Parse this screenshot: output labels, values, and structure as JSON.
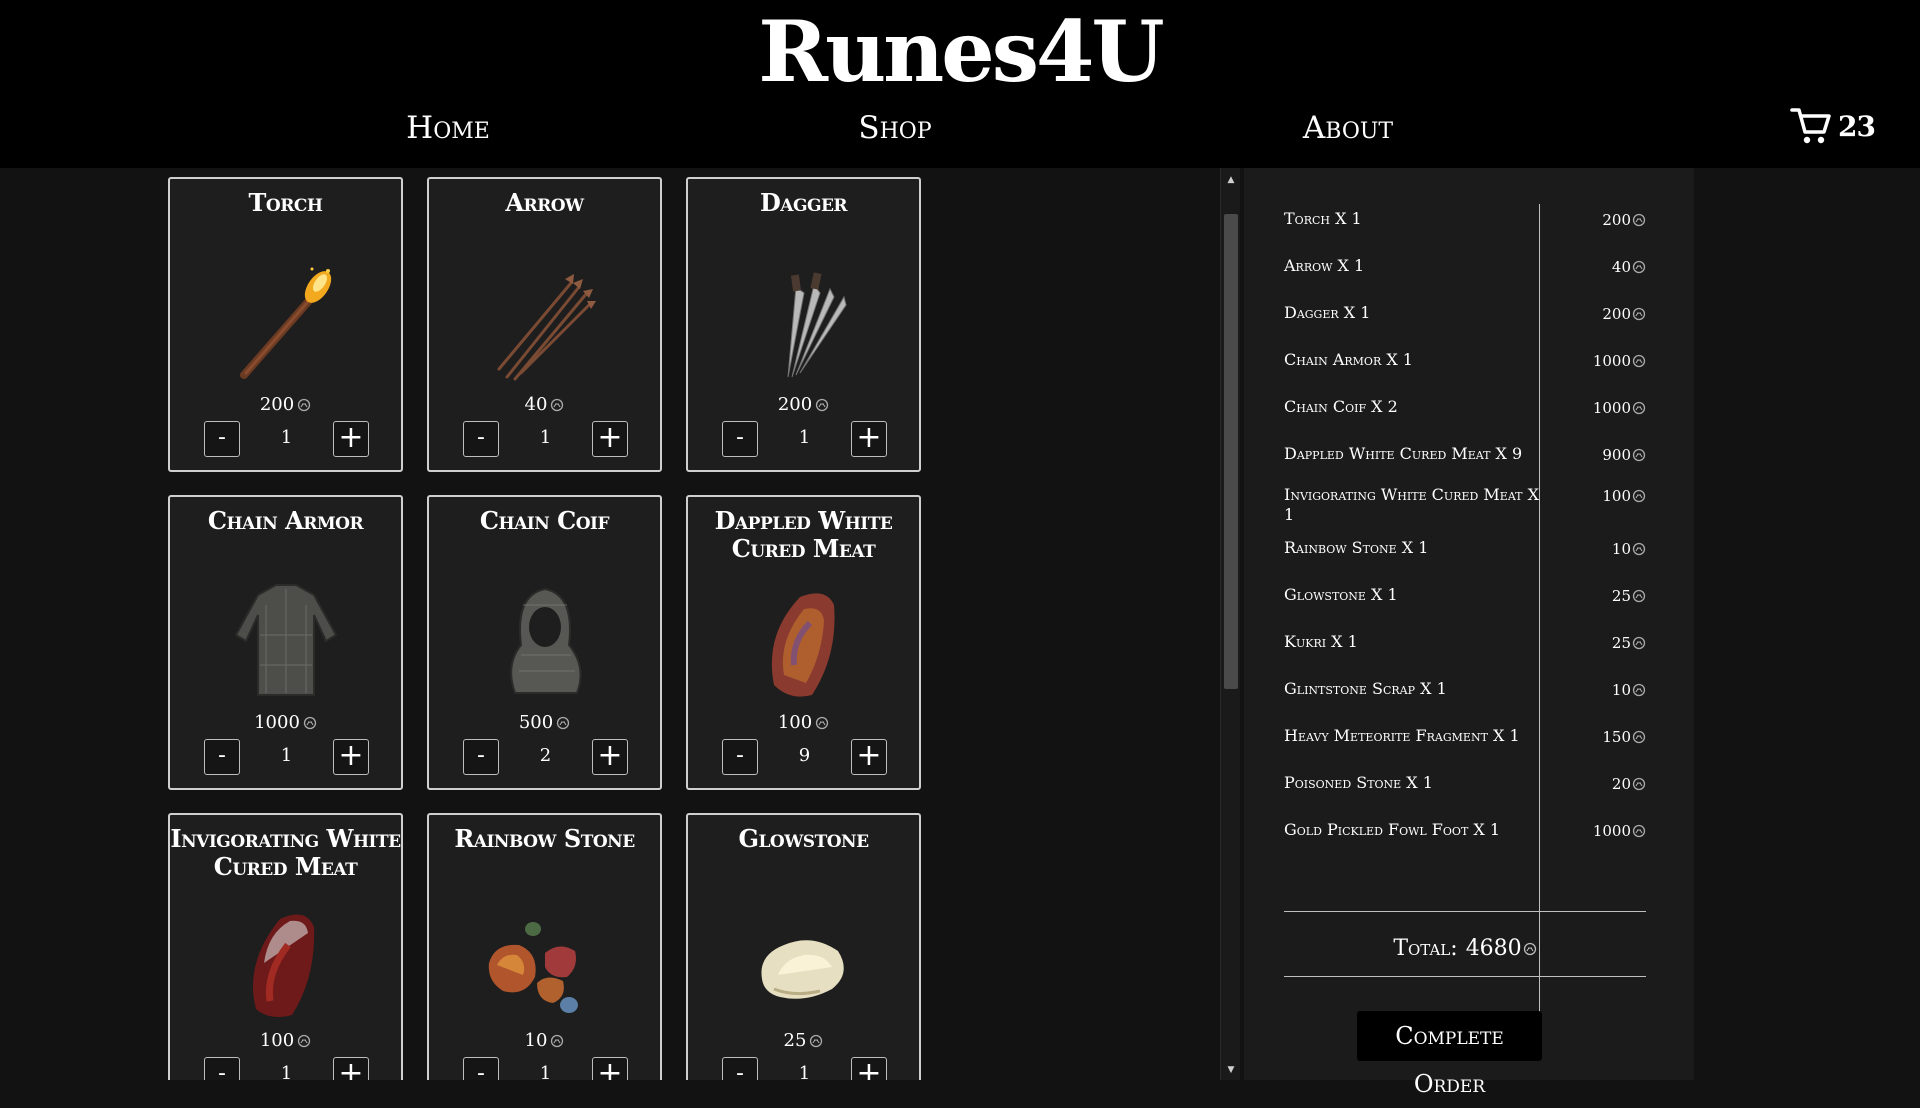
{
  "header": {
    "logo": "Runes4U",
    "nav": {
      "home": "Home",
      "shop": "Shop",
      "about": "About"
    },
    "cart_count": "23"
  },
  "products": [
    {
      "name": "Torch",
      "price": "200",
      "qty": "1",
      "image": "torch-icon"
    },
    {
      "name": "Arrow",
      "price": "40",
      "qty": "1",
      "image": "arrow-bundle-icon"
    },
    {
      "name": "Dagger",
      "price": "200",
      "qty": "1",
      "image": "dagger-icon"
    },
    {
      "name": "Chain Armor",
      "price": "1000",
      "qty": "1",
      "image": "chain-armor-icon"
    },
    {
      "name": "Chain Coif",
      "price": "500",
      "qty": "2",
      "image": "chain-coif-icon"
    },
    {
      "name": "Dappled White Cured Meat",
      "price": "100",
      "qty": "9",
      "image": "cured-meat-icon"
    },
    {
      "name": "Invigorating White Cured Meat",
      "price": "100",
      "qty": "1",
      "image": "cured-meat-red-icon"
    },
    {
      "name": "Rainbow Stone",
      "price": "10",
      "qty": "1",
      "image": "rainbow-stone-icon"
    },
    {
      "name": "Glowstone",
      "price": "25",
      "qty": "1",
      "image": "glowstone-icon"
    }
  ],
  "quantity_controls": {
    "minus": "-",
    "plus": "+"
  },
  "order": {
    "items": [
      {
        "label": "Torch X 1",
        "price": "200"
      },
      {
        "label": "Arrow X 1",
        "price": "40"
      },
      {
        "label": "Dagger X 1",
        "price": "200"
      },
      {
        "label": "Chain Armor X 1",
        "price": "1000"
      },
      {
        "label": "Chain Coif X 2",
        "price": "1000"
      },
      {
        "label": "Dappled White Cured Meat X 9",
        "price": "900"
      },
      {
        "label": "Invigorating White Cured Meat X 1",
        "price": "100"
      },
      {
        "label": "Rainbow Stone X 1",
        "price": "10"
      },
      {
        "label": "Glowstone X 1",
        "price": "25"
      },
      {
        "label": "Kukri X 1",
        "price": "25"
      },
      {
        "label": "Glintstone Scrap X 1",
        "price": "10"
      },
      {
        "label": "Heavy Meteorite Fragment X 1",
        "price": "150"
      },
      {
        "label": "Poisoned Stone X 1",
        "price": "20"
      },
      {
        "label": "Gold Pickled Fowl Foot X 1",
        "price": "1000"
      }
    ],
    "total_label": "Total:",
    "total_value": "4680",
    "complete_button": "Complete Order"
  },
  "colors": {
    "header_bg": "#000000",
    "page_bg": "#121212",
    "card_bg": "#1e1e1e",
    "card_border": "#cfcfcf",
    "order_panel_bg": "#1b1b1b",
    "text": "#ffffff"
  }
}
